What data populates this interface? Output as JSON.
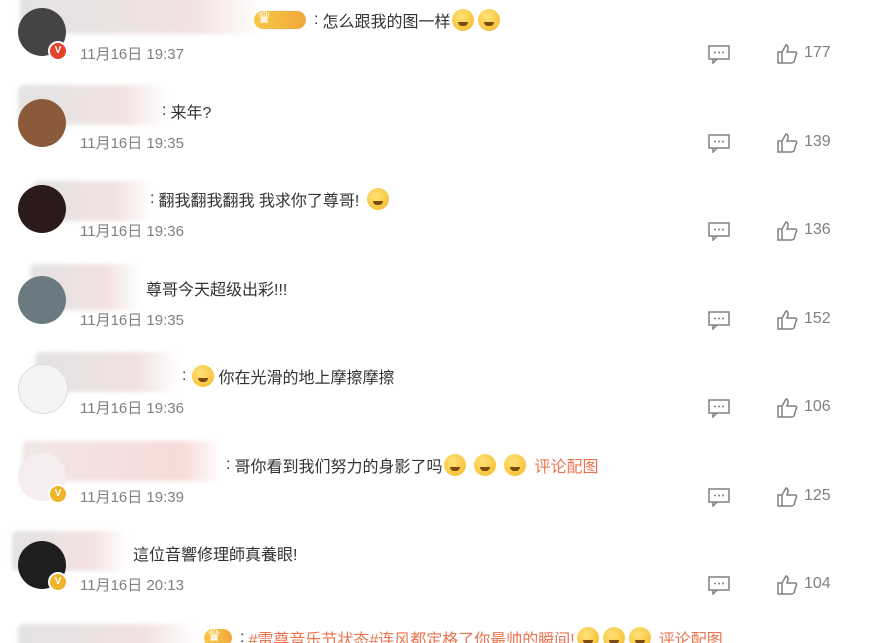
{
  "comments": [
    {
      "text": "怎么跟我的图一样",
      "time": "11月16日 19:37",
      "likes": "177",
      "emojis": 2,
      "link": ""
    },
    {
      "text": "来年?",
      "time": "11月16日 19:35",
      "likes": "139",
      "emojis": 0,
      "link": ""
    },
    {
      "text": "翻我翻我翻我 我求你了尊哥!",
      "time": "11月16日 19:36",
      "likes": "136",
      "emojis": 1,
      "link": ""
    },
    {
      "text": "尊哥今天超级出彩!!!",
      "time": "11月16日 19:35",
      "likes": "152",
      "emojis": 0,
      "link": ""
    },
    {
      "text": "你在光滑的地上摩擦摩擦",
      "time": "11月16日 19:36",
      "likes": "106",
      "emojis": 0,
      "link": ""
    },
    {
      "text": "哥你看到我们努力的身影了吗",
      "time": "11月16日 19:39",
      "likes": "125",
      "emojis": 3,
      "link": "评论配图"
    },
    {
      "text": "這位音響修理師真養眼!",
      "time": "11月16日 20:13",
      "likes": "104",
      "emojis": 0,
      "link": ""
    },
    {
      "text": "#雷尊音乐节状态#连风都定格了你最帅的瞬间!",
      "time": "",
      "likes": "",
      "emojis": 3,
      "link": "评论配图"
    }
  ],
  "colors": {
    "link": "#eb7350",
    "meta": "#808080",
    "badge_red": "#e2432b",
    "badge_gold": "#f0b429"
  }
}
